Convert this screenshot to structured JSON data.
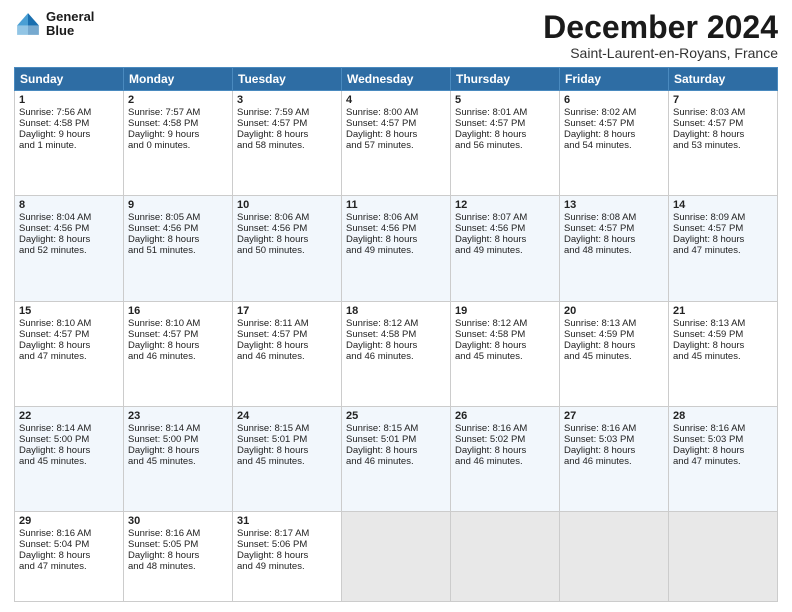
{
  "logo": {
    "line1": "General",
    "line2": "Blue"
  },
  "title": "December 2024",
  "subtitle": "Saint-Laurent-en-Royans, France",
  "days_of_week": [
    "Sunday",
    "Monday",
    "Tuesday",
    "Wednesday",
    "Thursday",
    "Friday",
    "Saturday"
  ],
  "weeks": [
    [
      {
        "day": "1",
        "lines": [
          "Sunrise: 7:56 AM",
          "Sunset: 4:58 PM",
          "Daylight: 9 hours",
          "and 1 minute."
        ]
      },
      {
        "day": "2",
        "lines": [
          "Sunrise: 7:57 AM",
          "Sunset: 4:58 PM",
          "Daylight: 9 hours",
          "and 0 minutes."
        ]
      },
      {
        "day": "3",
        "lines": [
          "Sunrise: 7:59 AM",
          "Sunset: 4:57 PM",
          "Daylight: 8 hours",
          "and 58 minutes."
        ]
      },
      {
        "day": "4",
        "lines": [
          "Sunrise: 8:00 AM",
          "Sunset: 4:57 PM",
          "Daylight: 8 hours",
          "and 57 minutes."
        ]
      },
      {
        "day": "5",
        "lines": [
          "Sunrise: 8:01 AM",
          "Sunset: 4:57 PM",
          "Daylight: 8 hours",
          "and 56 minutes."
        ]
      },
      {
        "day": "6",
        "lines": [
          "Sunrise: 8:02 AM",
          "Sunset: 4:57 PM",
          "Daylight: 8 hours",
          "and 54 minutes."
        ]
      },
      {
        "day": "7",
        "lines": [
          "Sunrise: 8:03 AM",
          "Sunset: 4:57 PM",
          "Daylight: 8 hours",
          "and 53 minutes."
        ]
      }
    ],
    [
      {
        "day": "8",
        "lines": [
          "Sunrise: 8:04 AM",
          "Sunset: 4:56 PM",
          "Daylight: 8 hours",
          "and 52 minutes."
        ]
      },
      {
        "day": "9",
        "lines": [
          "Sunrise: 8:05 AM",
          "Sunset: 4:56 PM",
          "Daylight: 8 hours",
          "and 51 minutes."
        ]
      },
      {
        "day": "10",
        "lines": [
          "Sunrise: 8:06 AM",
          "Sunset: 4:56 PM",
          "Daylight: 8 hours",
          "and 50 minutes."
        ]
      },
      {
        "day": "11",
        "lines": [
          "Sunrise: 8:06 AM",
          "Sunset: 4:56 PM",
          "Daylight: 8 hours",
          "and 49 minutes."
        ]
      },
      {
        "day": "12",
        "lines": [
          "Sunrise: 8:07 AM",
          "Sunset: 4:56 PM",
          "Daylight: 8 hours",
          "and 49 minutes."
        ]
      },
      {
        "day": "13",
        "lines": [
          "Sunrise: 8:08 AM",
          "Sunset: 4:57 PM",
          "Daylight: 8 hours",
          "and 48 minutes."
        ]
      },
      {
        "day": "14",
        "lines": [
          "Sunrise: 8:09 AM",
          "Sunset: 4:57 PM",
          "Daylight: 8 hours",
          "and 47 minutes."
        ]
      }
    ],
    [
      {
        "day": "15",
        "lines": [
          "Sunrise: 8:10 AM",
          "Sunset: 4:57 PM",
          "Daylight: 8 hours",
          "and 47 minutes."
        ]
      },
      {
        "day": "16",
        "lines": [
          "Sunrise: 8:10 AM",
          "Sunset: 4:57 PM",
          "Daylight: 8 hours",
          "and 46 minutes."
        ]
      },
      {
        "day": "17",
        "lines": [
          "Sunrise: 8:11 AM",
          "Sunset: 4:57 PM",
          "Daylight: 8 hours",
          "and 46 minutes."
        ]
      },
      {
        "day": "18",
        "lines": [
          "Sunrise: 8:12 AM",
          "Sunset: 4:58 PM",
          "Daylight: 8 hours",
          "and 46 minutes."
        ]
      },
      {
        "day": "19",
        "lines": [
          "Sunrise: 8:12 AM",
          "Sunset: 4:58 PM",
          "Daylight: 8 hours",
          "and 45 minutes."
        ]
      },
      {
        "day": "20",
        "lines": [
          "Sunrise: 8:13 AM",
          "Sunset: 4:59 PM",
          "Daylight: 8 hours",
          "and 45 minutes."
        ]
      },
      {
        "day": "21",
        "lines": [
          "Sunrise: 8:13 AM",
          "Sunset: 4:59 PM",
          "Daylight: 8 hours",
          "and 45 minutes."
        ]
      }
    ],
    [
      {
        "day": "22",
        "lines": [
          "Sunrise: 8:14 AM",
          "Sunset: 5:00 PM",
          "Daylight: 8 hours",
          "and 45 minutes."
        ]
      },
      {
        "day": "23",
        "lines": [
          "Sunrise: 8:14 AM",
          "Sunset: 5:00 PM",
          "Daylight: 8 hours",
          "and 45 minutes."
        ]
      },
      {
        "day": "24",
        "lines": [
          "Sunrise: 8:15 AM",
          "Sunset: 5:01 PM",
          "Daylight: 8 hours",
          "and 45 minutes."
        ]
      },
      {
        "day": "25",
        "lines": [
          "Sunrise: 8:15 AM",
          "Sunset: 5:01 PM",
          "Daylight: 8 hours",
          "and 46 minutes."
        ]
      },
      {
        "day": "26",
        "lines": [
          "Sunrise: 8:16 AM",
          "Sunset: 5:02 PM",
          "Daylight: 8 hours",
          "and 46 minutes."
        ]
      },
      {
        "day": "27",
        "lines": [
          "Sunrise: 8:16 AM",
          "Sunset: 5:03 PM",
          "Daylight: 8 hours",
          "and 46 minutes."
        ]
      },
      {
        "day": "28",
        "lines": [
          "Sunrise: 8:16 AM",
          "Sunset: 5:03 PM",
          "Daylight: 8 hours",
          "and 47 minutes."
        ]
      }
    ],
    [
      {
        "day": "29",
        "lines": [
          "Sunrise: 8:16 AM",
          "Sunset: 5:04 PM",
          "Daylight: 8 hours",
          "and 47 minutes."
        ]
      },
      {
        "day": "30",
        "lines": [
          "Sunrise: 8:16 AM",
          "Sunset: 5:05 PM",
          "Daylight: 8 hours",
          "and 48 minutes."
        ]
      },
      {
        "day": "31",
        "lines": [
          "Sunrise: 8:17 AM",
          "Sunset: 5:06 PM",
          "Daylight: 8 hours",
          "and 49 minutes."
        ]
      },
      null,
      null,
      null,
      null
    ]
  ]
}
